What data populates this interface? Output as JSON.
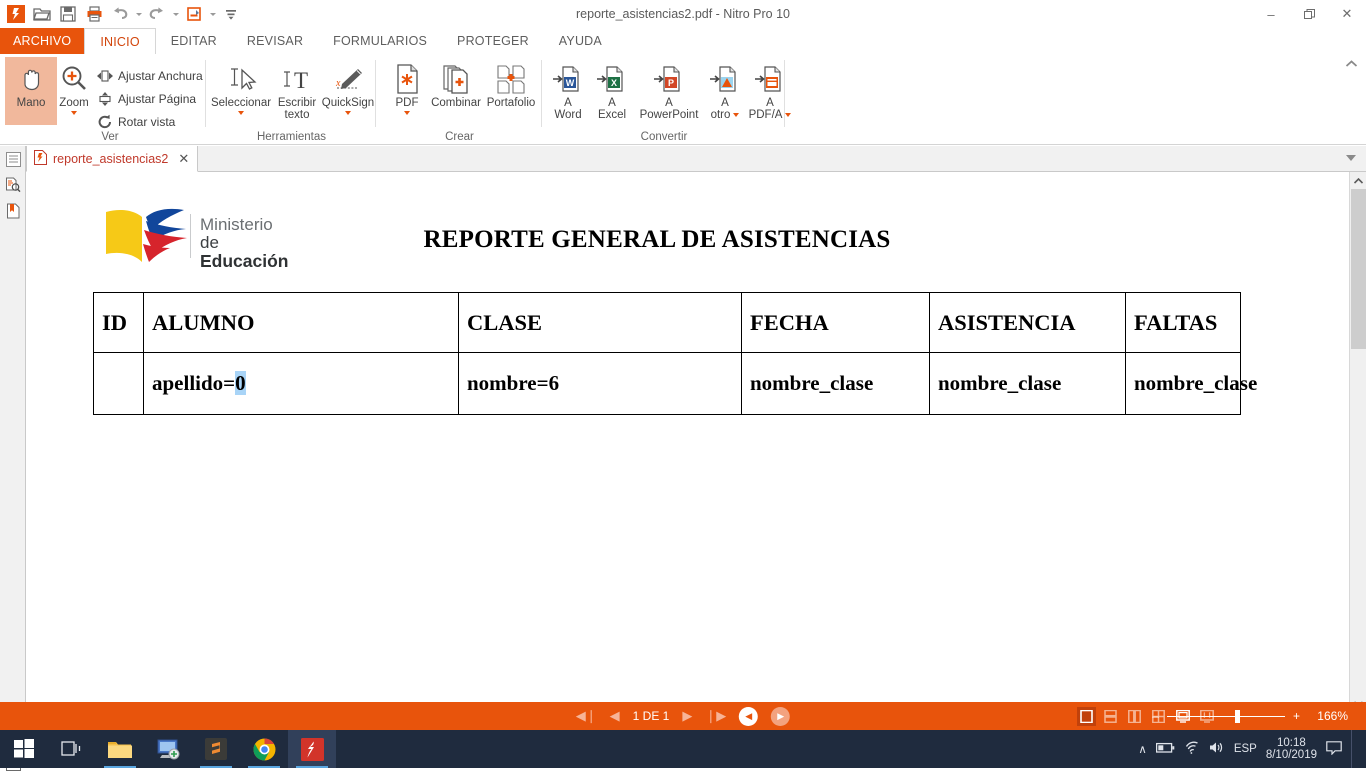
{
  "window": {
    "title": "reporte_asistencias2.pdf - Nitro Pro 10",
    "minimize": "–",
    "restore": "❐",
    "close": "✕"
  },
  "quick_access": {
    "items": [
      {
        "name": "nitro-logo-icon",
        "label": ""
      },
      {
        "name": "open-icon",
        "label": ""
      },
      {
        "name": "save-icon",
        "label": ""
      },
      {
        "name": "print-icon",
        "label": ""
      },
      {
        "name": "undo-icon",
        "label": ""
      },
      {
        "name": "redo-icon",
        "label": ""
      },
      {
        "name": "quick-properties-icon",
        "label": ""
      },
      {
        "name": "customize-qat-icon",
        "label": ""
      }
    ]
  },
  "ribbon": {
    "tabs": [
      {
        "label": "ARCHIVO",
        "active": false,
        "file": true
      },
      {
        "label": "INICIO",
        "active": true,
        "file": false
      },
      {
        "label": "EDITAR",
        "active": false,
        "file": false
      },
      {
        "label": "REVISAR",
        "active": false,
        "file": false
      },
      {
        "label": "FORMULARIOS",
        "active": false,
        "file": false
      },
      {
        "label": "PROTEGER",
        "active": false,
        "file": false
      },
      {
        "label": "AYUDA",
        "active": false,
        "file": false
      }
    ],
    "groups": {
      "ver": {
        "label": "Ver",
        "mano": "Mano",
        "zoom": "Zoom",
        "ajustar_anchura": "Ajustar Anchura",
        "ajustar_pagina": "Ajustar Página",
        "rotar_vista": "Rotar vista"
      },
      "herramientas": {
        "label": "Herramientas",
        "seleccionar": "Seleccionar",
        "escribir_texto_1": "Escribir",
        "escribir_texto_2": "texto",
        "quicksign": "QuickSign"
      },
      "crear": {
        "label": "Crear",
        "pdf": "PDF",
        "combinar": "Combinar",
        "portafolio": "Portafolio"
      },
      "convertir": {
        "label": "Convertir",
        "a": "A",
        "word": "Word",
        "excel": "Excel",
        "powerpoint": "PowerPoint",
        "otro": "otro",
        "pdfa": "PDF/A"
      }
    }
  },
  "document_tab": {
    "label": "reporte_asistencias2",
    "close": "✕"
  },
  "rail": {
    "items": [
      {
        "name": "panel-toggle-icon"
      },
      {
        "name": "page-thumbnails-search-icon"
      },
      {
        "name": "bookmarks-icon"
      },
      {
        "name": "comments-icon"
      },
      {
        "name": "attachments-icon"
      },
      {
        "name": "layers-list-icon"
      }
    ]
  },
  "document": {
    "logo": {
      "line1": "Ministerio",
      "line2_prefix": "de ",
      "line2_bold": "Educación",
      "colors": {
        "yellow": "#f6c917",
        "blue": "#11469b",
        "red": "#d6242c"
      }
    },
    "title": "REPORTE GENERAL DE ASISTENCIAS",
    "table": {
      "headers": [
        "ID",
        "ALUMNO",
        "CLASE",
        "FECHA",
        "ASISTENCIA",
        "FALTAS"
      ],
      "rows": [
        {
          "id": "",
          "alumno_prefix": "apellido=",
          "alumno_selected": "0",
          "clase": "nombre=6",
          "fecha": "nombre_clase",
          "asistencia": "nombre_clase",
          "faltas": "nombre_clase"
        }
      ]
    }
  },
  "status_bar": {
    "first_page": "◀❘",
    "prev_page": "◀",
    "page_indicator": "1 DE 1",
    "next_page": "▶",
    "last_page": "❘▶",
    "prev_view": "◀",
    "next_view": "▶",
    "view_modes": [
      {
        "name": "view-single-page",
        "active": true
      },
      {
        "name": "view-continuous",
        "active": false
      },
      {
        "name": "view-two-up",
        "active": false
      },
      {
        "name": "view-two-up-continuous",
        "active": false
      },
      {
        "name": "view-fit-page",
        "active": false
      },
      {
        "name": "view-fit-width",
        "active": false
      }
    ],
    "zoom_out": "–",
    "zoom_in": "+",
    "zoom_level": "166%"
  },
  "taskbar": {
    "items": [
      {
        "name": "start-button-icon",
        "running": false,
        "active": false
      },
      {
        "name": "task-view-icon",
        "running": false,
        "active": false
      },
      {
        "name": "file-explorer-icon",
        "running": true,
        "active": false
      },
      {
        "name": "remote-desktop-icon",
        "running": false,
        "active": false
      },
      {
        "name": "sublime-text-icon",
        "running": true,
        "active": false
      },
      {
        "name": "google-chrome-icon",
        "running": true,
        "active": false
      },
      {
        "name": "nitro-pro-icon",
        "running": true,
        "active": true
      }
    ],
    "tray": {
      "show_hidden": "∧",
      "battery": "battery-icon",
      "network": "wifi-icon",
      "volume": "volume-icon",
      "language": "ESP",
      "time": "10:18",
      "date": "8/10/2019",
      "action_center": "notifications-icon"
    }
  }
}
